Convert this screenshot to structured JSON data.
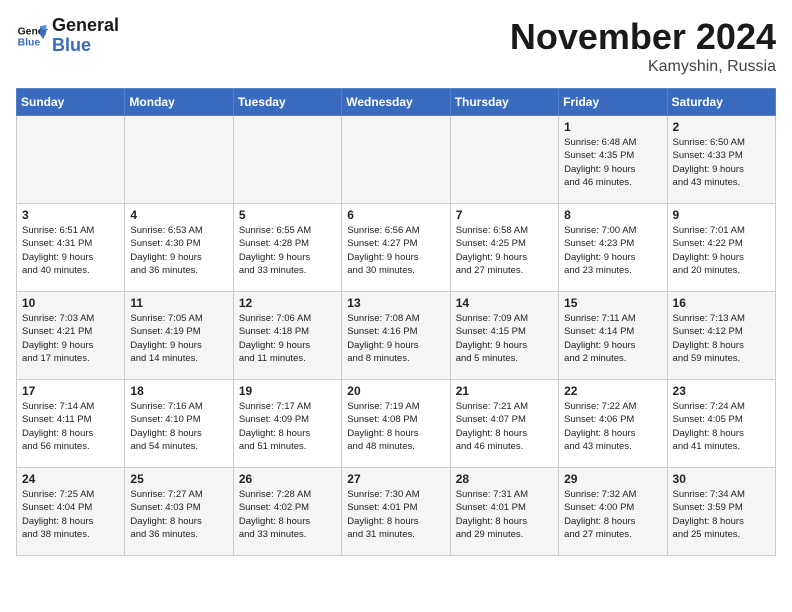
{
  "header": {
    "logo_line1": "General",
    "logo_line2": "Blue",
    "month_title": "November 2024",
    "location": "Kamyshin, Russia"
  },
  "weekdays": [
    "Sunday",
    "Monday",
    "Tuesday",
    "Wednesday",
    "Thursday",
    "Friday",
    "Saturday"
  ],
  "weeks": [
    [
      {
        "day": "",
        "detail": ""
      },
      {
        "day": "",
        "detail": ""
      },
      {
        "day": "",
        "detail": ""
      },
      {
        "day": "",
        "detail": ""
      },
      {
        "day": "",
        "detail": ""
      },
      {
        "day": "1",
        "detail": "Sunrise: 6:48 AM\nSunset: 4:35 PM\nDaylight: 9 hours\nand 46 minutes."
      },
      {
        "day": "2",
        "detail": "Sunrise: 6:50 AM\nSunset: 4:33 PM\nDaylight: 9 hours\nand 43 minutes."
      }
    ],
    [
      {
        "day": "3",
        "detail": "Sunrise: 6:51 AM\nSunset: 4:31 PM\nDaylight: 9 hours\nand 40 minutes."
      },
      {
        "day": "4",
        "detail": "Sunrise: 6:53 AM\nSunset: 4:30 PM\nDaylight: 9 hours\nand 36 minutes."
      },
      {
        "day": "5",
        "detail": "Sunrise: 6:55 AM\nSunset: 4:28 PM\nDaylight: 9 hours\nand 33 minutes."
      },
      {
        "day": "6",
        "detail": "Sunrise: 6:56 AM\nSunset: 4:27 PM\nDaylight: 9 hours\nand 30 minutes."
      },
      {
        "day": "7",
        "detail": "Sunrise: 6:58 AM\nSunset: 4:25 PM\nDaylight: 9 hours\nand 27 minutes."
      },
      {
        "day": "8",
        "detail": "Sunrise: 7:00 AM\nSunset: 4:23 PM\nDaylight: 9 hours\nand 23 minutes."
      },
      {
        "day": "9",
        "detail": "Sunrise: 7:01 AM\nSunset: 4:22 PM\nDaylight: 9 hours\nand 20 minutes."
      }
    ],
    [
      {
        "day": "10",
        "detail": "Sunrise: 7:03 AM\nSunset: 4:21 PM\nDaylight: 9 hours\nand 17 minutes."
      },
      {
        "day": "11",
        "detail": "Sunrise: 7:05 AM\nSunset: 4:19 PM\nDaylight: 9 hours\nand 14 minutes."
      },
      {
        "day": "12",
        "detail": "Sunrise: 7:06 AM\nSunset: 4:18 PM\nDaylight: 9 hours\nand 11 minutes."
      },
      {
        "day": "13",
        "detail": "Sunrise: 7:08 AM\nSunset: 4:16 PM\nDaylight: 9 hours\nand 8 minutes."
      },
      {
        "day": "14",
        "detail": "Sunrise: 7:09 AM\nSunset: 4:15 PM\nDaylight: 9 hours\nand 5 minutes."
      },
      {
        "day": "15",
        "detail": "Sunrise: 7:11 AM\nSunset: 4:14 PM\nDaylight: 9 hours\nand 2 minutes."
      },
      {
        "day": "16",
        "detail": "Sunrise: 7:13 AM\nSunset: 4:12 PM\nDaylight: 8 hours\nand 59 minutes."
      }
    ],
    [
      {
        "day": "17",
        "detail": "Sunrise: 7:14 AM\nSunset: 4:11 PM\nDaylight: 8 hours\nand 56 minutes."
      },
      {
        "day": "18",
        "detail": "Sunrise: 7:16 AM\nSunset: 4:10 PM\nDaylight: 8 hours\nand 54 minutes."
      },
      {
        "day": "19",
        "detail": "Sunrise: 7:17 AM\nSunset: 4:09 PM\nDaylight: 8 hours\nand 51 minutes."
      },
      {
        "day": "20",
        "detail": "Sunrise: 7:19 AM\nSunset: 4:08 PM\nDaylight: 8 hours\nand 48 minutes."
      },
      {
        "day": "21",
        "detail": "Sunrise: 7:21 AM\nSunset: 4:07 PM\nDaylight: 8 hours\nand 46 minutes."
      },
      {
        "day": "22",
        "detail": "Sunrise: 7:22 AM\nSunset: 4:06 PM\nDaylight: 8 hours\nand 43 minutes."
      },
      {
        "day": "23",
        "detail": "Sunrise: 7:24 AM\nSunset: 4:05 PM\nDaylight: 8 hours\nand 41 minutes."
      }
    ],
    [
      {
        "day": "24",
        "detail": "Sunrise: 7:25 AM\nSunset: 4:04 PM\nDaylight: 8 hours\nand 38 minutes."
      },
      {
        "day": "25",
        "detail": "Sunrise: 7:27 AM\nSunset: 4:03 PM\nDaylight: 8 hours\nand 36 minutes."
      },
      {
        "day": "26",
        "detail": "Sunrise: 7:28 AM\nSunset: 4:02 PM\nDaylight: 8 hours\nand 33 minutes."
      },
      {
        "day": "27",
        "detail": "Sunrise: 7:30 AM\nSunset: 4:01 PM\nDaylight: 8 hours\nand 31 minutes."
      },
      {
        "day": "28",
        "detail": "Sunrise: 7:31 AM\nSunset: 4:01 PM\nDaylight: 8 hours\nand 29 minutes."
      },
      {
        "day": "29",
        "detail": "Sunrise: 7:32 AM\nSunset: 4:00 PM\nDaylight: 8 hours\nand 27 minutes."
      },
      {
        "day": "30",
        "detail": "Sunrise: 7:34 AM\nSunset: 3:59 PM\nDaylight: 8 hours\nand 25 minutes."
      }
    ]
  ]
}
